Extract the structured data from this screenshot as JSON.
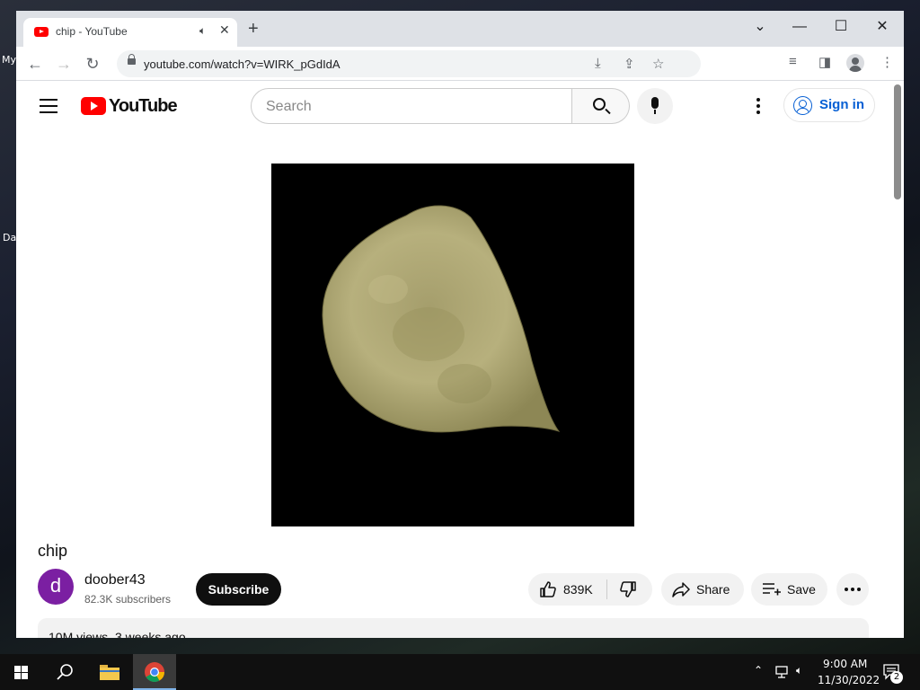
{
  "desktop": {
    "label_my": "My",
    "label_da": "Da"
  },
  "browser": {
    "tab": {
      "title": "chip - YouTube"
    },
    "address": {
      "url": "youtube.com/watch?v=WIRK_pGdIdA"
    }
  },
  "youtube": {
    "logo_text": "YouTube",
    "search": {
      "placeholder": "Search",
      "value": ""
    },
    "signin_label": "Sign in",
    "video": {
      "title": "chip",
      "channel_initial": "d",
      "channel_name": "doober43",
      "subscribers": "82.3K subscribers",
      "subscribe_label": "Subscribe",
      "likes": "839K",
      "share_label": "Share",
      "save_label": "Save",
      "views": "10M views",
      "uploaded": "3 weeks ago"
    }
  },
  "taskbar": {
    "time": "9:00 AM",
    "date": "11/30/2022",
    "notification_count": "2"
  },
  "colors": {
    "youtube_red": "#ff0000",
    "link_blue": "#065fd4",
    "chip": "#b5ae7c"
  }
}
